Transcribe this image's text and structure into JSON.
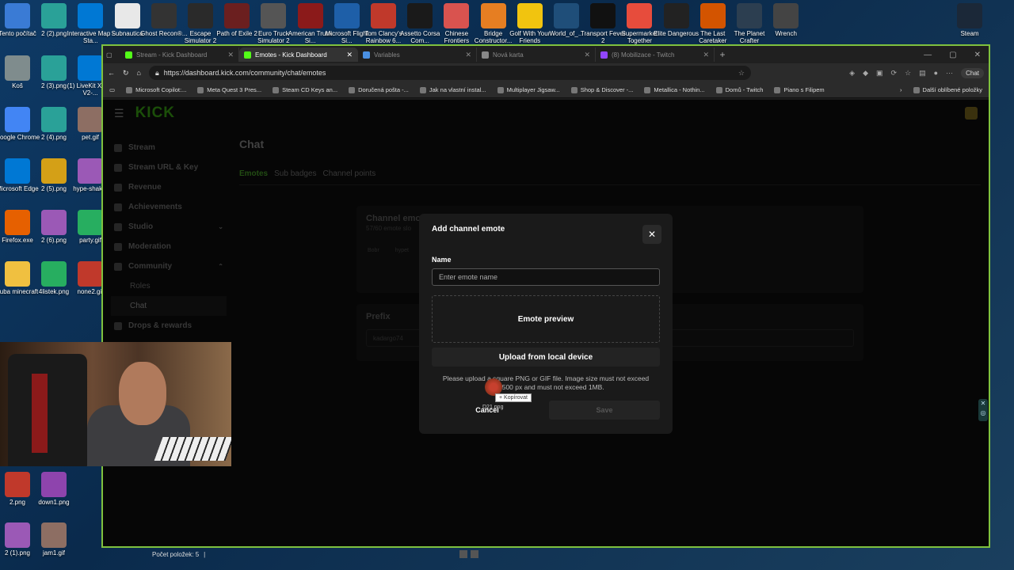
{
  "desktop_icons_top": [
    {
      "label": "Tento počítač",
      "color": "#3a7bd5"
    },
    {
      "label": "2 (2).png",
      "color": "#2aa198"
    },
    {
      "label": "Interactive Map - Sta...",
      "color": "#0078d4"
    },
    {
      "label": "Subnautica",
      "color": "#e8e8e8"
    },
    {
      "label": "Ghost Recon®...",
      "color": "#333333"
    },
    {
      "label": "Escape Simulator 2",
      "color": "#2a2a2a"
    },
    {
      "label": "Path of Exile 2",
      "color": "#6b1f1f"
    },
    {
      "label": "Euro Truck Simulator 2",
      "color": "#555555"
    },
    {
      "label": "American Truck Si...",
      "color": "#8b1a1a"
    },
    {
      "label": "Microsoft Flight Si...",
      "color": "#1e5fa8"
    },
    {
      "label": "Tom Clancy's Rainbow 6...",
      "color": "#c0392b"
    },
    {
      "label": "Assetto Corsa Com...",
      "color": "#1a1a1a"
    },
    {
      "label": "Chinese Frontiers",
      "color": "#d9534f"
    },
    {
      "label": "Bridge Constructor...",
      "color": "#e67e22"
    },
    {
      "label": "Golf With Your Friends",
      "color": "#f1c40f"
    },
    {
      "label": "World_of_...",
      "color": "#1f4e79"
    },
    {
      "label": "Transport Fever 2",
      "color": "#111111"
    },
    {
      "label": "Supermarket Together",
      "color": "#e74c3c"
    },
    {
      "label": "Elite Dangerous",
      "color": "#222222"
    },
    {
      "label": "The Last Caretaker",
      "color": "#d35400"
    },
    {
      "label": "The Planet Crafter",
      "color": "#2c3e50"
    },
    {
      "label": "Wrench",
      "color": "#444444"
    },
    {
      "label": "Steam",
      "color": "#1b2838"
    }
  ],
  "desktop_icons_left": [
    {
      "label": "Koš",
      "color": "#7f8c8d"
    },
    {
      "label": "2 (3).png",
      "color": "#2aa198"
    },
    {
      "label": "(1) LiveKit XTTS V2-...",
      "color": "#0078d4"
    },
    {
      "label": "Google Chrome",
      "color": "#4285f4"
    },
    {
      "label": "2 (4).png",
      "color": "#2aa198"
    },
    {
      "label": "pet.gif",
      "color": "#8d6e63"
    },
    {
      "label": "Microsoft Edge",
      "color": "#0078d4"
    },
    {
      "label": "2 (5).png",
      "color": "#d4a017"
    },
    {
      "label": "hype-shak...",
      "color": "#9b59b6"
    },
    {
      "label": "Firefox.exe",
      "color": "#e66000"
    },
    {
      "label": "2 (6).png",
      "color": "#9b59b6"
    },
    {
      "label": "party.gif",
      "color": "#27ae60"
    },
    {
      "label": "kuba minecraft",
      "color": "#f0c040"
    },
    {
      "label": "4listek.png",
      "color": "#27ae60"
    },
    {
      "label": "none2.gif",
      "color": "#c0392b"
    },
    {
      "label": "2.png",
      "color": "#c0392b"
    },
    {
      "label": "down1.png",
      "color": "#8e44ad"
    },
    {
      "label": "2 (1).png",
      "color": "#9b59b6"
    },
    {
      "label": "jam1.gif",
      "color": "#8d6e63"
    }
  ],
  "browser": {
    "tabs": [
      {
        "label": "Stream - Kick Dashboard",
        "active": false,
        "color": "#53fc18"
      },
      {
        "label": "Emotes - Kick Dashboard",
        "active": true,
        "color": "#53fc18"
      },
      {
        "label": "Variables",
        "active": false,
        "color": "#4a90e2"
      },
      {
        "label": "Nová karta",
        "active": false,
        "color": "#888888"
      },
      {
        "label": "(8) Mobilizace - Twitch",
        "active": false,
        "color": "#9146ff"
      }
    ],
    "url": "https://dashboard.kick.com/community/chat/emotes",
    "chat_label": "Chat",
    "favorites": [
      "Microsoft Copilot:...",
      "Meta Quest 3 Pres...",
      "Steam CD Keys an...",
      "Doručená pošta -...",
      "Jak na vlastní instal...",
      "Multiplayer Jigsaw...",
      "Shop & Discover -...",
      "Metallica - Nothin...",
      "Domů - Twitch",
      "Piano s Filipem"
    ],
    "other_favorites": "Další oblíbené položky"
  },
  "kick": {
    "logo": "KICK",
    "sidebar": [
      {
        "label": "Stream",
        "sub": false
      },
      {
        "label": "Stream URL & Key",
        "sub": false
      },
      {
        "label": "Revenue",
        "sub": false
      },
      {
        "label": "Achievements",
        "sub": false
      },
      {
        "label": "Studio",
        "sub": false,
        "chevron": "⌄"
      },
      {
        "label": "Moderation",
        "sub": false
      },
      {
        "label": "Community",
        "sub": false,
        "chevron": "⌃"
      },
      {
        "label": "Roles",
        "sub": true
      },
      {
        "label": "Chat",
        "sub": true,
        "selected": true
      },
      {
        "label": "Drops & rewards",
        "sub": false
      }
    ],
    "page_title": "Chat",
    "subtabs": [
      "Emotes",
      "Sub badges",
      "Channel points"
    ],
    "bg_channel_emotes": "Channel emo",
    "bg_emote_count": "57/60 emote slo",
    "bg_emote_names": [
      "Bobr",
      "hypet"
    ],
    "bg_prefix": "Prefix",
    "bg_prefix_value": "kadargo74"
  },
  "modal": {
    "title": "Add channel emote",
    "close": "✕",
    "name_label": "Name",
    "name_placeholder": "Enter emote name",
    "preview_label": "Emote preview",
    "upload_label": "Upload from local device",
    "note_line1": "Please upload a square PNG or GIF file. Image size must not exceed",
    "note_line2": "500x500 px and must not exceed 1MB.",
    "cancel": "Cancel",
    "save": "Save"
  },
  "drag": {
    "tooltip": "+ Kopírovat",
    "file_name": "D21.png"
  },
  "statusbar": {
    "text": "Počet položek: 5"
  }
}
